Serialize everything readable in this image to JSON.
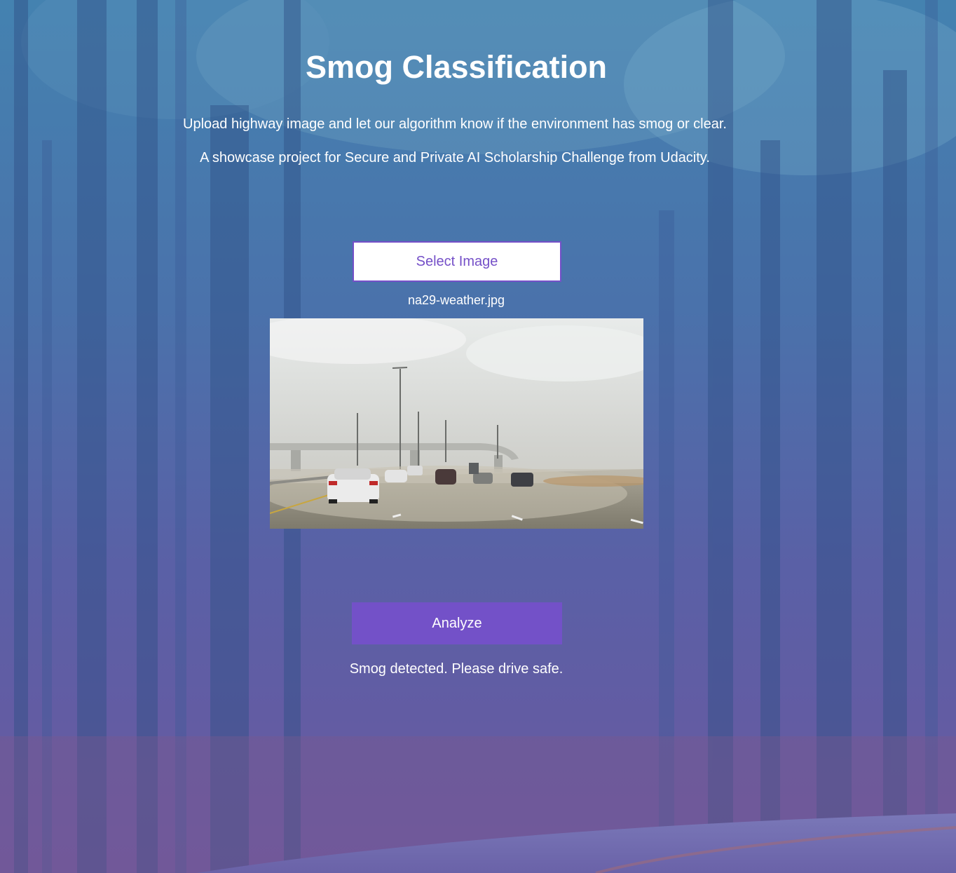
{
  "header": {
    "title": "Smog Classification",
    "subtitle_1": "Upload highway image and let our algorithm know if the environment has smog or clear.",
    "subtitle_2": "A showcase project for Secure and Private AI Scholarship Challenge from Udacity."
  },
  "upload": {
    "select_label": "Select Image",
    "file_name": "na29-weather.jpg"
  },
  "actions": {
    "analyze_label": "Analyze"
  },
  "result": {
    "message": "Smog detected. Please drive safe."
  },
  "colors": {
    "accent": "#7351c8",
    "bg_top": "#3f7fae",
    "bg_bottom": "#6a5aa0"
  }
}
